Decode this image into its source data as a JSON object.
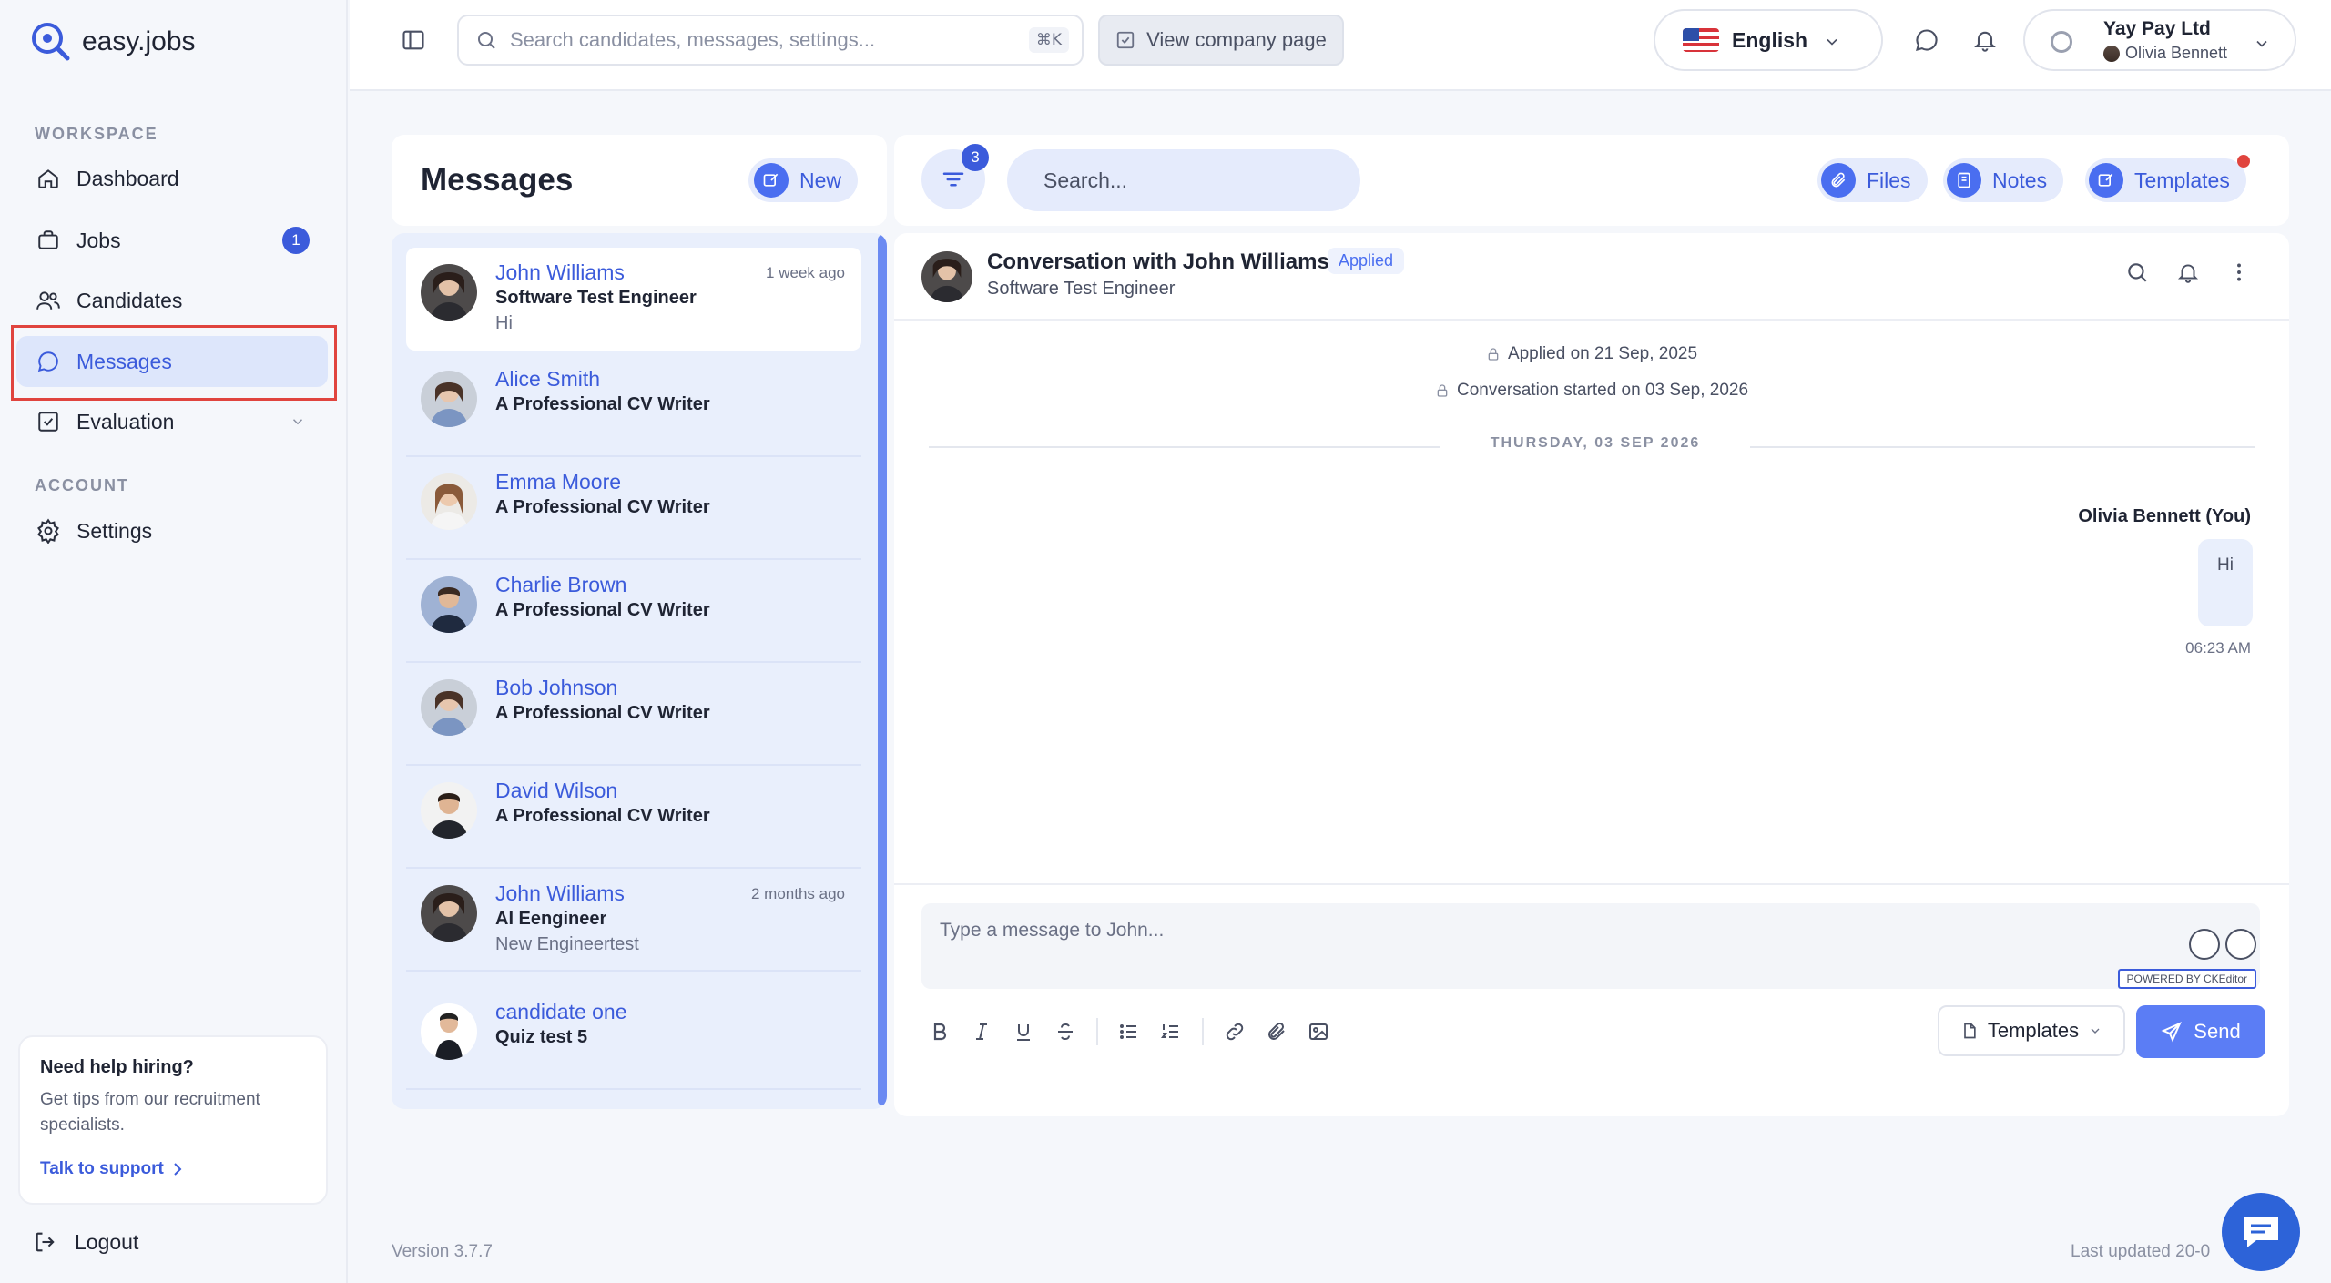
{
  "brand": {
    "name": "easy.jobs"
  },
  "sidebar": {
    "workspace_label": "WORKSPACE",
    "account_label": "ACCOUNT",
    "items": [
      {
        "label": "Dashboard",
        "icon": "home-icon"
      },
      {
        "label": "Jobs",
        "icon": "briefcase-icon",
        "badge": "1"
      },
      {
        "label": "Candidates",
        "icon": "users-icon"
      },
      {
        "label": "Messages",
        "icon": "chat-icon",
        "active": true
      },
      {
        "label": "Evaluation",
        "icon": "checklist-icon"
      }
    ],
    "settings_label": "Settings",
    "help": {
      "title": "Need help hiring?",
      "text": "Get tips from our recruitment specialists.",
      "link": "Talk to support"
    },
    "logout_label": "Logout"
  },
  "topbar": {
    "search_placeholder": "Search candidates, messages, settings...",
    "shortcut": "⌘K",
    "company_page_label": "View company page",
    "language": "English",
    "company": "Yay Pay Ltd",
    "user": "Olivia Bennett"
  },
  "messages": {
    "title": "Messages",
    "new_label": "New",
    "filter_count": "3",
    "search_placeholder": "Search...",
    "files_label": "Files",
    "notes_label": "Notes",
    "templates_label": "Templates",
    "conversations": [
      {
        "name": "John Williams",
        "role": "Software Test Engineer",
        "snippet": "Hi",
        "time": "1 week ago"
      },
      {
        "name": "Alice Smith",
        "role": "A Professional CV Writer",
        "snippet": "",
        "time": ""
      },
      {
        "name": "Emma Moore",
        "role": "A Professional CV Writer",
        "snippet": "",
        "time": ""
      },
      {
        "name": "Charlie Brown",
        "role": "A Professional CV Writer",
        "snippet": "",
        "time": ""
      },
      {
        "name": "Bob Johnson",
        "role": "A Professional CV Writer",
        "snippet": "",
        "time": ""
      },
      {
        "name": "David Wilson",
        "role": "A Professional CV Writer",
        "snippet": "",
        "time": ""
      },
      {
        "name": "John Williams",
        "role": "AI Eengineer",
        "snippet": "New Engineertest",
        "time": "2 months ago"
      },
      {
        "name": "candidate one",
        "role": "Quiz test 5",
        "snippet": "",
        "time": ""
      }
    ]
  },
  "conversation": {
    "title": "Conversation with John Williams",
    "status": "Applied",
    "subtitle": "Software Test Engineer",
    "applied_on": "Applied on 21 Sep, 2025",
    "started_on": "Conversation started on 03 Sep, 2026",
    "day_label": "THURSDAY, 03 SEP 2026",
    "sender": "Olivia Bennett (You)",
    "message": "Hi",
    "message_time": "06:23 AM",
    "input_placeholder": "Type a message to John...",
    "ckeditor_label": "POWERED BY CKEditor",
    "templates_label": "Templates",
    "send_label": "Send"
  },
  "footer": {
    "version": "Version 3.7.7",
    "last_updated": "Last updated 20-0"
  }
}
